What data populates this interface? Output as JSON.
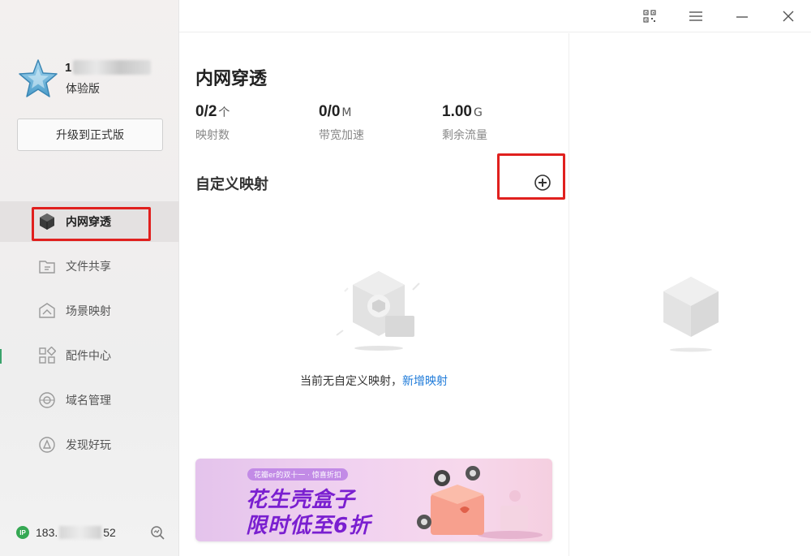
{
  "user": {
    "name_visible": "1",
    "edition": "体验版",
    "upgrade_label": "升级到正式版"
  },
  "nav": {
    "items": [
      {
        "label": "内网穿透",
        "icon": "cube-icon",
        "active": true
      },
      {
        "label": "文件共享",
        "icon": "folder-share-icon",
        "active": false
      },
      {
        "label": "场景映射",
        "icon": "scene-map-icon",
        "active": false
      },
      {
        "label": "配件中心",
        "icon": "apps-grid-icon",
        "active": false
      },
      {
        "label": "域名管理",
        "icon": "domain-globe-icon",
        "active": false
      },
      {
        "label": "发现好玩",
        "icon": "discover-icon",
        "active": false
      }
    ]
  },
  "ip": {
    "badge": "IP",
    "prefix": "183.",
    "suffix": "52"
  },
  "main": {
    "title": "内网穿透",
    "stats": [
      {
        "value": "0/2",
        "unit": "个",
        "caption": "映射数"
      },
      {
        "value": "0/0",
        "unit": "M",
        "caption": "带宽加速"
      },
      {
        "value": "1.00",
        "unit": "G",
        "caption": "剩余流量"
      }
    ],
    "section_title": "自定义映射",
    "empty_text": "当前无自定义映射，",
    "empty_link": "新增映射"
  },
  "banner": {
    "tag": "花瓣er的双十一 · 惊喜折扣",
    "line1": "花生壳盒子",
    "line2": "限时低至6折"
  },
  "colors": {
    "highlight": "#e0201e",
    "link": "#1d7ad9",
    "ip_badge": "#35a853",
    "banner_text": "#7a1fd0"
  }
}
